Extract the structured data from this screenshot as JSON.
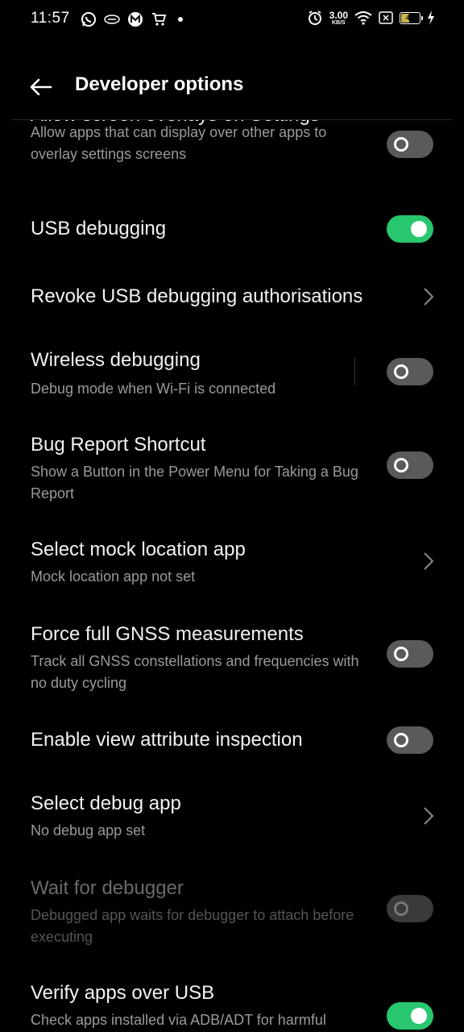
{
  "status_bar": {
    "time": "11:57",
    "net_speed_value": "3.00",
    "net_speed_unit": "KB/S",
    "battery_level": "47",
    "battery_fraction": 0.47
  },
  "header": {
    "title": "Developer options"
  },
  "settings": [
    {
      "title": "Allow screen overlays on Settings",
      "subtitle": "Allow apps that can display over other apps to overlay settings screens",
      "control": "toggle",
      "state": "off"
    },
    {
      "title": "USB debugging",
      "subtitle": "",
      "control": "toggle",
      "state": "on"
    },
    {
      "title": "Revoke USB debugging authorisations",
      "subtitle": "",
      "control": "chevron"
    },
    {
      "title": "Wireless debugging",
      "subtitle": "Debug mode when Wi-Fi is connected",
      "control": "toggle",
      "state": "off"
    },
    {
      "title": "Bug Report Shortcut",
      "subtitle": "Show a Button in the Power Menu for Taking a Bug Report",
      "control": "toggle",
      "state": "off"
    },
    {
      "title": "Select mock location app",
      "subtitle": "Mock location app not set",
      "control": "chevron"
    },
    {
      "title": "Force full GNSS measurements",
      "subtitle": "Track all GNSS constellations and frequencies with no duty cycling",
      "control": "toggle",
      "state": "off"
    },
    {
      "title": "Enable view attribute inspection",
      "subtitle": "",
      "control": "toggle",
      "state": "off"
    },
    {
      "title": "Select debug app",
      "subtitle": "No debug app set",
      "control": "chevron"
    },
    {
      "title": "Wait for debugger",
      "subtitle": "Debugged app waits for debugger to attach before executing",
      "control": "toggle",
      "state": "disabled"
    },
    {
      "title": "Verify apps over USB",
      "subtitle": "Check apps installed via ADB/ADT for harmful",
      "control": "toggle",
      "state": "on"
    }
  ],
  "colors": {
    "background": "#000000",
    "toggle_on": "#28c76f",
    "toggle_off": "#5a5a5a",
    "subtitle_text": "#9a9a9a"
  },
  "icons": {
    "status_left": [
      "whatsapp-icon",
      "notification-icon",
      "m-app-icon",
      "cart-icon",
      "dot-icon"
    ],
    "status_right": [
      "alarm-icon",
      "wifi-icon",
      "sim-icon",
      "battery-icon",
      "charging-icon"
    ],
    "header": "back-arrow-icon",
    "row_nav": "chevron-right-icon"
  }
}
